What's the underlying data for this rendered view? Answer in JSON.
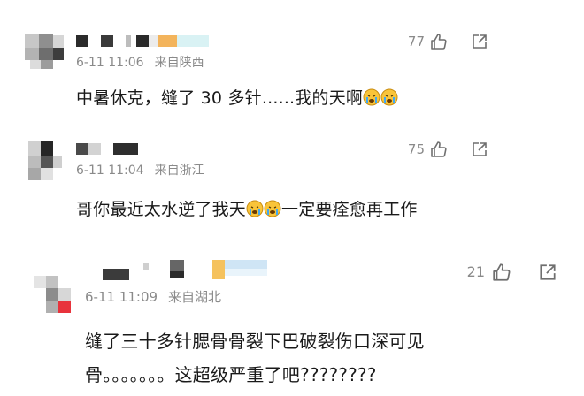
{
  "comments": [
    {
      "time": "6-11 11:06",
      "location": "来自陕西",
      "likes": "77",
      "text": "中暑休克，缝了 30 多针......我的天啊",
      "emoji": [
        "crying-face",
        "crying-face"
      ],
      "text_after_emoji": ""
    },
    {
      "time": "6-11 11:04",
      "location": "来自浙江",
      "likes": "75",
      "text": "哥你最近太水逆了我天",
      "emoji": [
        "crying-face",
        "crying-face"
      ],
      "text_after_emoji": "一定要痊愈再工作"
    },
    {
      "time": "6-11 11:09",
      "location": "来自湖北",
      "likes": "21",
      "text_line1": "缝了三十多针腮骨骨裂下巴破裂伤口深可见",
      "text_line2": "骨。。。。。。。这超级严重了吧????????"
    }
  ],
  "icons": {
    "like": "thumbs-up-outline-icon",
    "share": "share-arrow-icon"
  }
}
